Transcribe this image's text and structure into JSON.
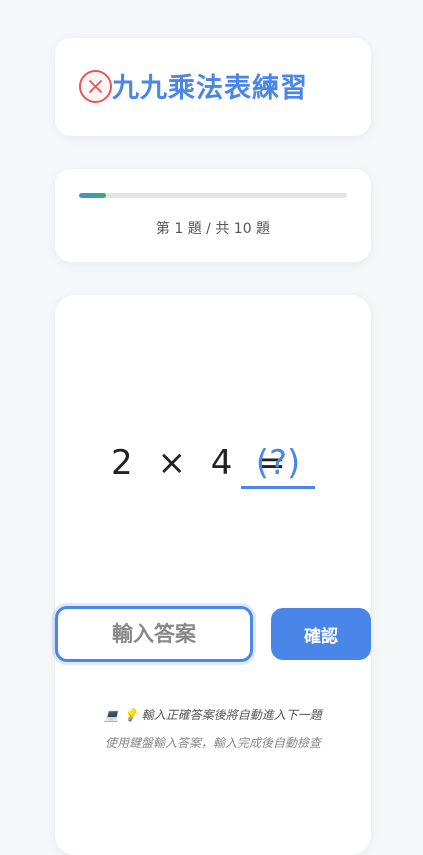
{
  "header": {
    "title": "九九乘法表練習",
    "close_icon": "close-icon",
    "accent_color": "#4a86e8",
    "close_color": "#e05a5a"
  },
  "progress": {
    "current": 1,
    "total": 10,
    "fraction": 0.1,
    "text": "第 1 題 / 共 10 題"
  },
  "question": {
    "operand_a": "2",
    "operator": "×",
    "operand_b": "4",
    "equals": "=",
    "answer_placeholder": "(?)"
  },
  "answer": {
    "placeholder": "輸入答案",
    "value": ""
  },
  "confirm": {
    "label": "確認"
  },
  "hints": {
    "line1": "💻 💡 輸入正確答案後將自動進入下一題",
    "line2": "使用鍵盤輸入答案，輸入完成後自動檢查"
  }
}
